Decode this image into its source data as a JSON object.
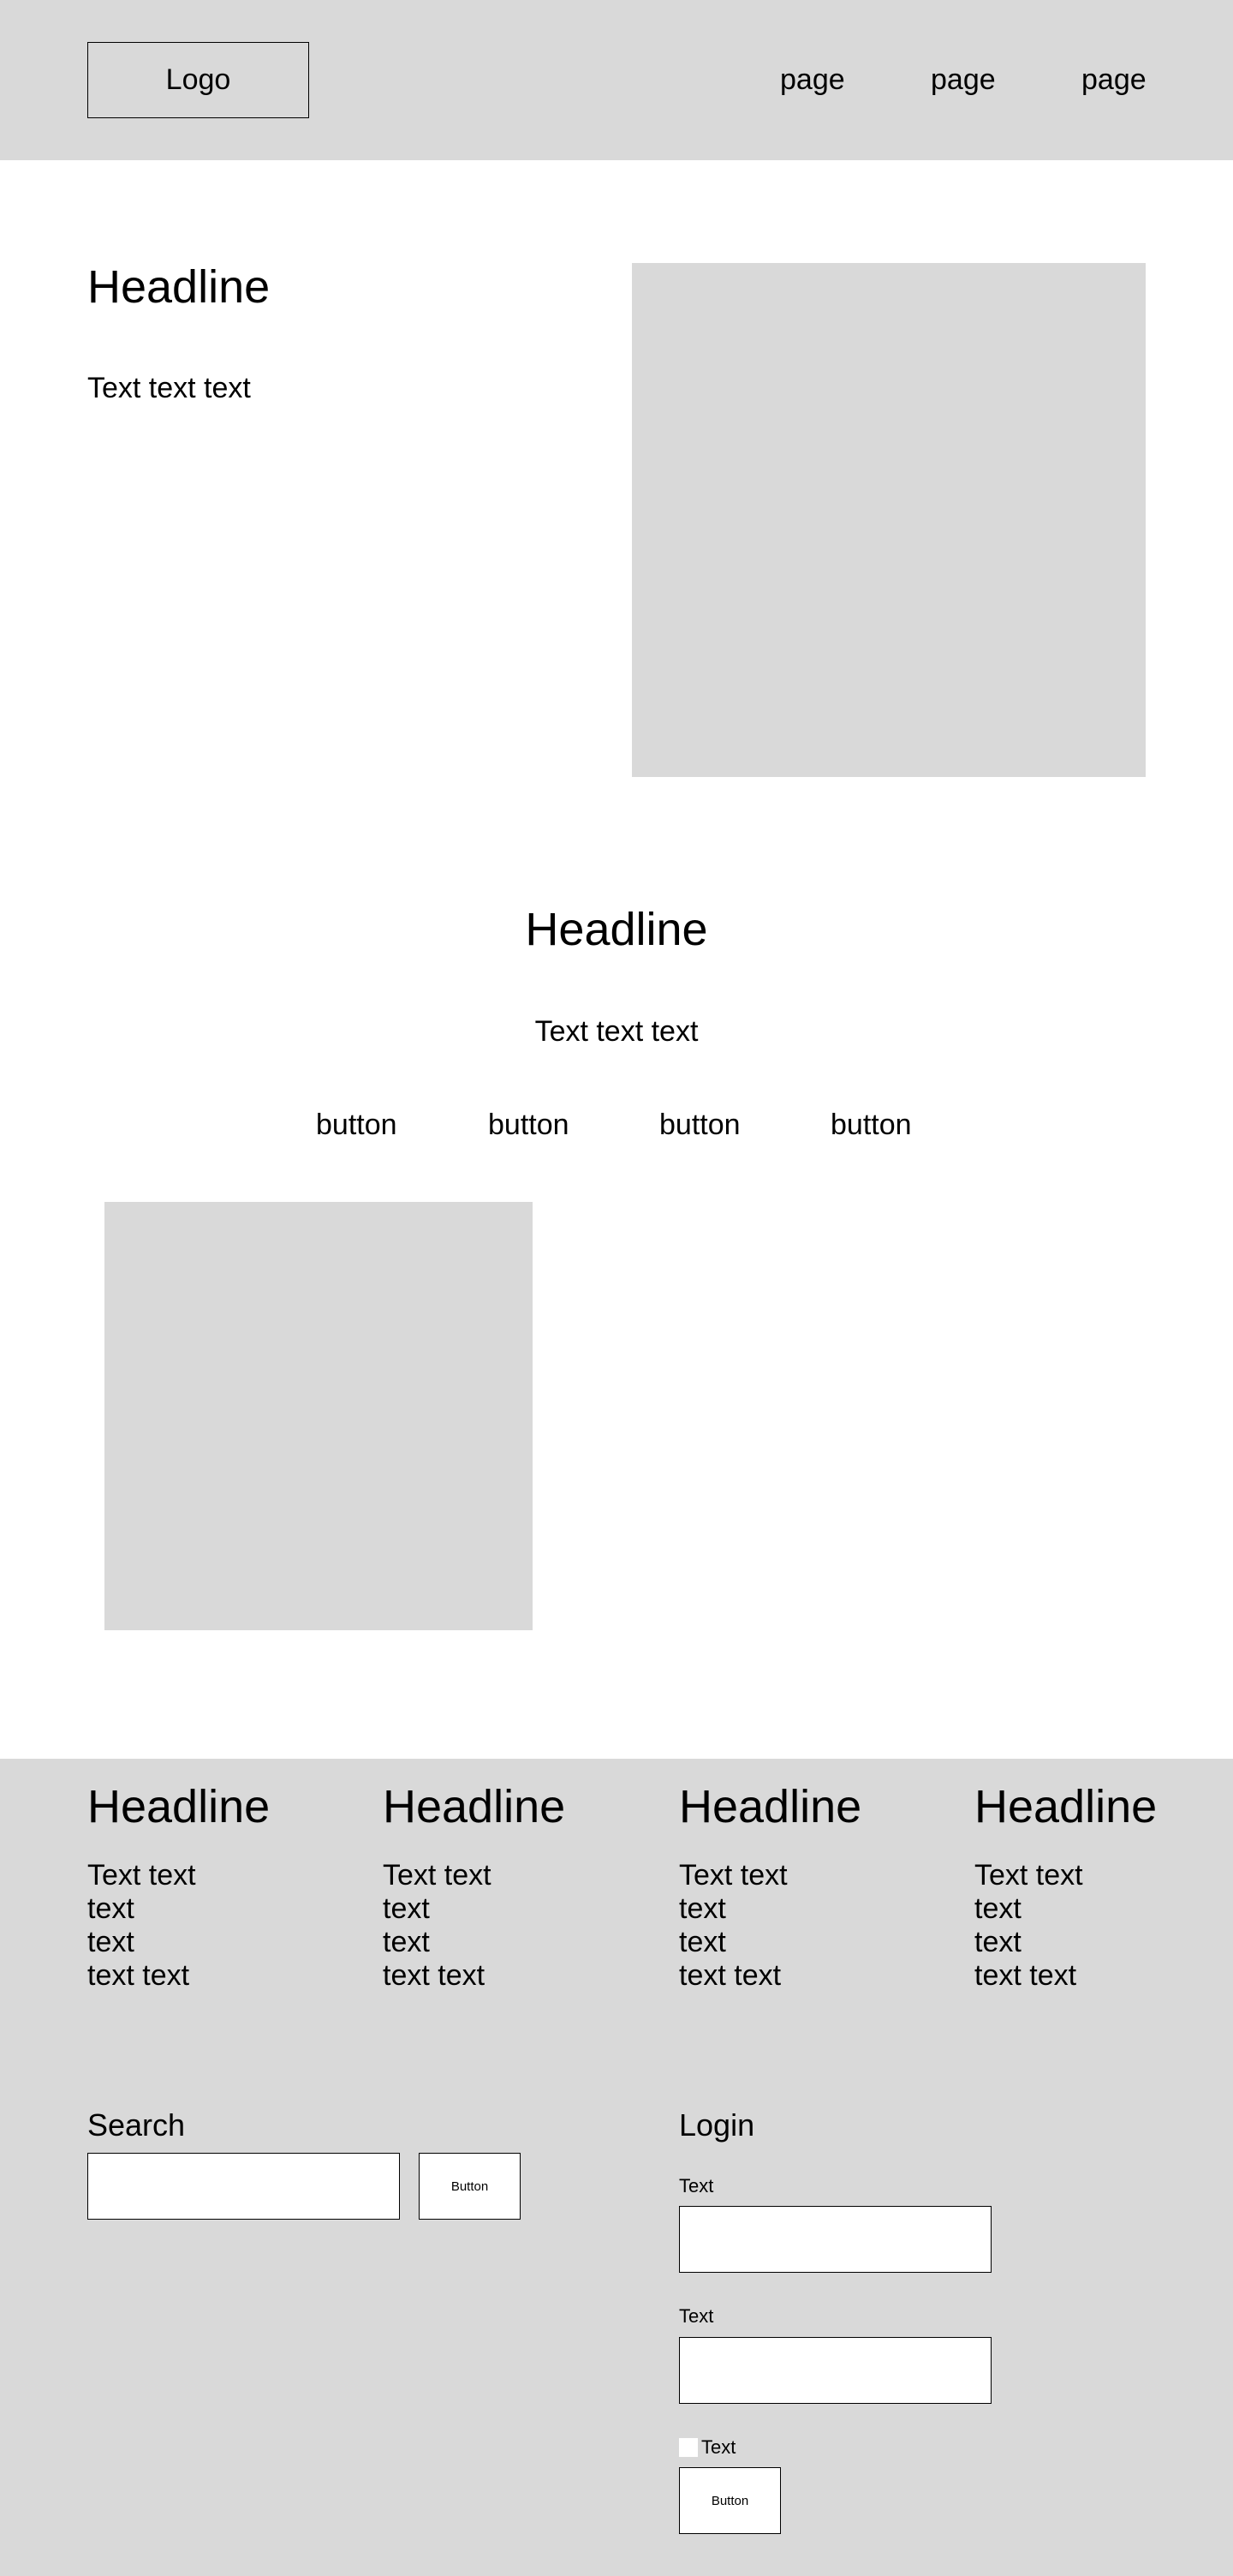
{
  "header": {
    "logo": "Logo",
    "nav": [
      "page",
      "page",
      "page"
    ]
  },
  "hero": {
    "headline": "Headline",
    "text": "Text text text"
  },
  "middle": {
    "headline": "Headline",
    "text": "Text text text",
    "buttons": [
      "button",
      "button",
      "button",
      "button"
    ]
  },
  "footer": {
    "columns": [
      {
        "headline": "Headline",
        "lines": [
          "Text text",
          "text",
          "text",
          "text text"
        ]
      },
      {
        "headline": "Headline",
        "lines": [
          "Text text",
          "text",
          "text",
          "text text"
        ]
      },
      {
        "headline": "Headline",
        "lines": [
          "Text text",
          "text",
          "text",
          "text text"
        ]
      },
      {
        "headline": "Headline",
        "lines": [
          "Text text",
          "text",
          "text",
          "text text"
        ]
      }
    ],
    "search": {
      "title": "Search",
      "input_value": "",
      "button": "Button"
    },
    "login": {
      "title": "Login",
      "field1_label": "Text",
      "field1_value": "",
      "field2_label": "Text",
      "field2_value": "",
      "checkbox_label": "Text",
      "checkbox_checked": false,
      "button": "Button"
    }
  },
  "colors": {
    "gray": "#d9d9d9",
    "white": "#ffffff",
    "border": "#000000"
  }
}
